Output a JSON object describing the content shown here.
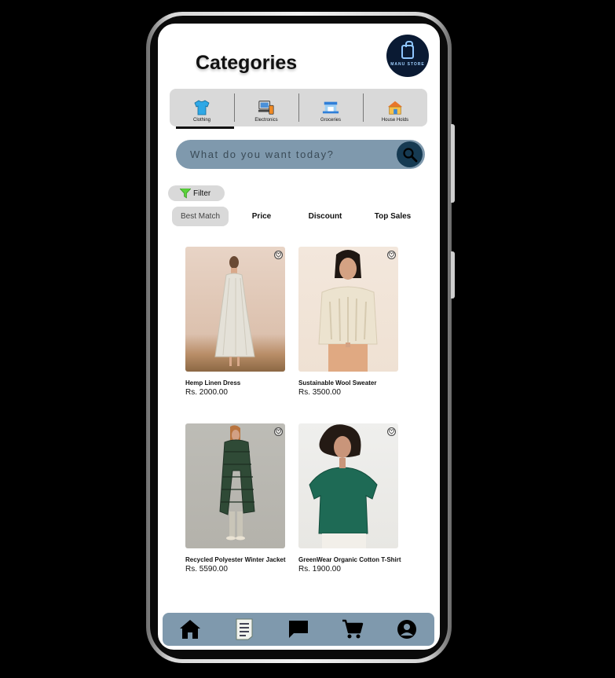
{
  "header": {
    "title": "Categories",
    "logo_text": "MANU STORE"
  },
  "categories": [
    {
      "label": "Clothing",
      "icon": "tshirt-icon",
      "active": true
    },
    {
      "label": "Electronics",
      "icon": "devices-icon",
      "active": false
    },
    {
      "label": "Groceries",
      "icon": "store-icon",
      "active": false
    },
    {
      "label": "House Holds",
      "icon": "house-icon",
      "active": false
    }
  ],
  "search": {
    "placeholder": "What do you want today?"
  },
  "filter": {
    "label": "Filter"
  },
  "sort_options": [
    {
      "label": "Best Match",
      "active": true
    },
    {
      "label": "Price",
      "active": false
    },
    {
      "label": "Discount",
      "active": false
    },
    {
      "label": "Top Sales",
      "active": false
    }
  ],
  "products": [
    {
      "name": "Hemp Linen Dress",
      "price": "Rs. 2000.00"
    },
    {
      "name": "Sustainable Wool Sweater",
      "price": "Rs. 3500.00"
    },
    {
      "name": "Recycled Polyester Winter Jacket",
      "price": "Rs. 5590.00"
    },
    {
      "name": "GreenWear Organic Cotton T-Shirt",
      "price": "Rs. 1900.00"
    }
  ],
  "bottom_nav": [
    {
      "icon": "home-icon",
      "active": true
    },
    {
      "icon": "orders-icon",
      "active": false
    },
    {
      "icon": "chat-icon",
      "active": false
    },
    {
      "icon": "cart-icon",
      "active": false
    },
    {
      "icon": "profile-icon",
      "active": false
    }
  ],
  "colors": {
    "accent": "#7f99ad",
    "chip_bg": "#d9d9d9",
    "search_button": "#163a52"
  }
}
